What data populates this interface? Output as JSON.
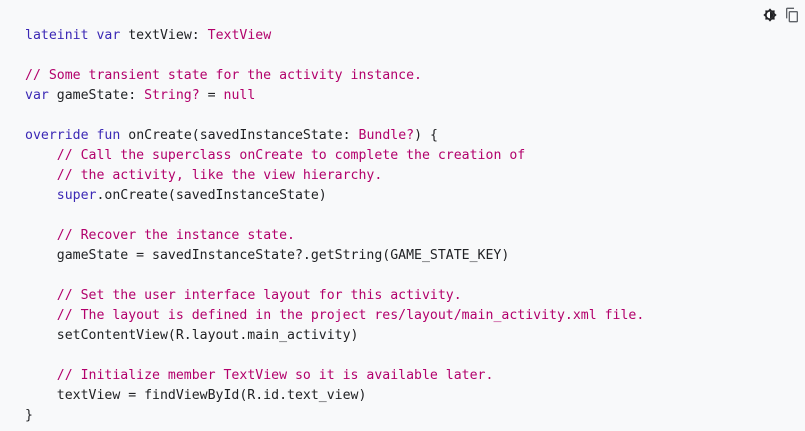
{
  "toolbar": {
    "theme_icon": "brightness-icon",
    "copy_icon": "copy-icon"
  },
  "colors": {
    "background": "#f8f9fa",
    "keyword": "#3b28b5",
    "type": "#b2006b",
    "comment": "#b2006b",
    "text": "#202124"
  },
  "code": {
    "l1": {
      "t1": "lateinit ",
      "t2": "var",
      "t3": " textView: ",
      "t4": "TextView"
    },
    "l3": {
      "t1": "// Some transient state for the activity instance."
    },
    "l4": {
      "t1": "var",
      "t2": " gameState: ",
      "t3": "String?",
      "t4": " = ",
      "t5": "null"
    },
    "l6": {
      "t1": "override",
      "t2": " ",
      "t3": "fun",
      "t4": " onCreate(savedInstanceState: ",
      "t5": "Bundle?",
      "t6": ") {"
    },
    "l7": {
      "t1": "    ",
      "t2": "// Call the superclass onCreate to complete the creation of"
    },
    "l8": {
      "t1": "    ",
      "t2": "// the activity, like the view hierarchy."
    },
    "l9": {
      "t1": "    ",
      "t2": "super",
      "t3": ".onCreate(savedInstanceState)"
    },
    "l11": {
      "t1": "    ",
      "t2": "// Recover the instance state."
    },
    "l12": {
      "t1": "    gameState = savedInstanceState?.getString(GAME_STATE_KEY)"
    },
    "l14": {
      "t1": "    ",
      "t2": "// Set the user interface layout for this activity."
    },
    "l15": {
      "t1": "    ",
      "t2": "// The layout is defined in the project res/layout/main_activity.xml file."
    },
    "l16": {
      "t1": "    setContentView(R.layout.main_activity)"
    },
    "l18": {
      "t1": "    ",
      "t2": "// Initialize member TextView so it is available later."
    },
    "l19": {
      "t1": "    textView = findViewById(R.id.text_view)"
    },
    "l20": {
      "t1": "}"
    }
  }
}
